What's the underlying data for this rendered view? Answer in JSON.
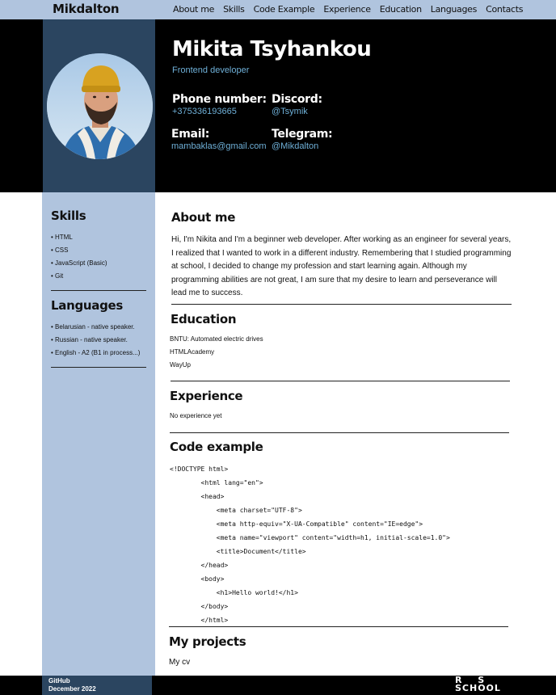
{
  "nav": {
    "brand": "Mikdalton",
    "items": [
      "About me",
      "Skills",
      "Code Example",
      "Experience",
      "Education",
      "Languages",
      "Contacts"
    ]
  },
  "hero": {
    "name": "Mikita Tsyhankou",
    "role": "Frontend developer",
    "contacts": [
      {
        "label": "Phone number:",
        "value": "+375336193665"
      },
      {
        "label": "Discord:",
        "value": "@Tsymik"
      },
      {
        "label": "Email:",
        "value": "mambaklas@gmail.com"
      },
      {
        "label": "Telegram:",
        "value": "@Mikdalton"
      }
    ]
  },
  "sidebar": {
    "skills_title": "Skills",
    "skills": [
      "HTML",
      "CSS",
      "JavaScript (Basic)",
      "Git"
    ],
    "languages_title": "Languages",
    "languages": [
      "Belarusian - native speaker.",
      "Russian - native speaker.",
      "English - A2 (B1 in process...)"
    ]
  },
  "main": {
    "about_title": "About me",
    "about_text": "Hi, I'm Nikita and I'm a beginner web developer. After working as an engineer for several years, I realized that I wanted to work in a different industry. Remembering that I studied programming at school, I decided to change my profession and start learning again. Although my programming abilities are not great, I am sure that my desire to learn and perseverance will lead me to success.",
    "education_title": "Education",
    "education": [
      "BNTU: Automated electric drives",
      "HTMLAcademy",
      "WayUp"
    ],
    "experience_title": "Experience",
    "experience_text": "No experience yet",
    "code_title": "Code example",
    "code_lines": [
      "<!DOCTYPE html>",
      "        <html lang=\"en\">",
      "        <head>",
      "            <meta charset=\"UTF-8\">",
      "            <meta http-equiv=\"X-UA-Compatible\" content=\"IE=edge\">",
      "            <meta name=\"viewport\" content=\"width=h1, initial-scale=1.0\">",
      "            <title>Document</title>",
      "        </head>",
      "        <body>",
      "            <h1>Hello world!</h1>",
      "        </body>",
      "        </html>"
    ],
    "projects_title": "My projects",
    "projects": [
      "My cv"
    ]
  },
  "footer": {
    "github": "GitHub",
    "date": "December 2022",
    "logo_text": [
      "R S",
      "SCHOOL"
    ]
  },
  "colors": {
    "nav_bg": "#b0c4de",
    "hero_bg": "#000000",
    "hero_side": "#2b4560",
    "accent_text": "#6fb0d8"
  }
}
